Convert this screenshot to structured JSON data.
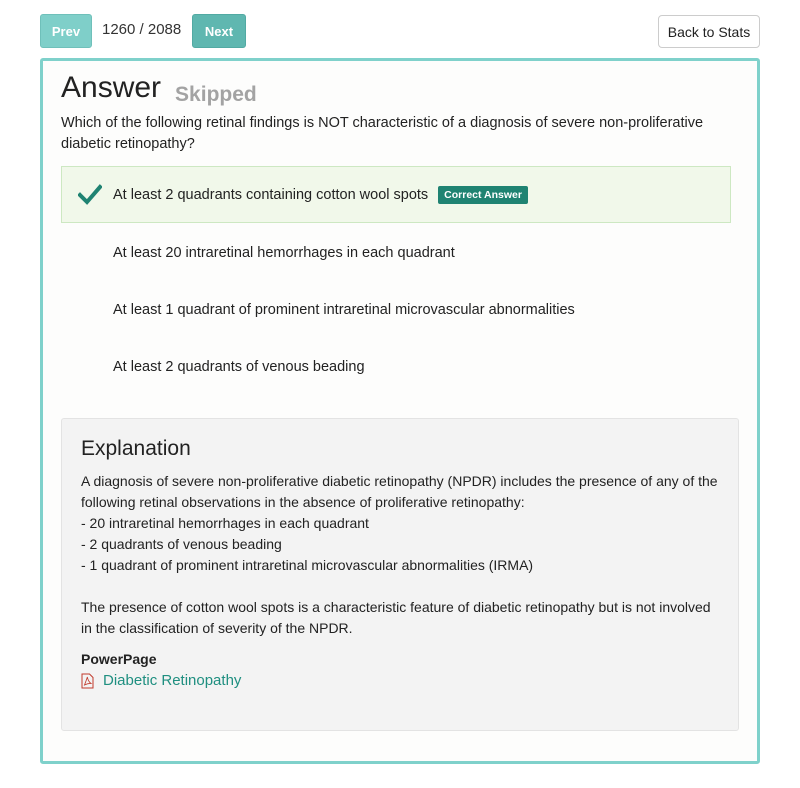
{
  "nav": {
    "prev_label": "Prev",
    "counter": "1260 / 2088",
    "next_label": "Next",
    "back_label": "Back to Stats"
  },
  "answer": {
    "title": "Answer",
    "status": "Skipped",
    "question": "Which of the following retinal findings is NOT characteristic of a diagnosis of severe non-proliferative diabetic retinopathy?",
    "options": [
      {
        "text": "At least 2 quadrants containing cotton wool spots",
        "correct": true
      },
      {
        "text": "At least 20 intraretinal hemorrhages in each quadrant",
        "correct": false
      },
      {
        "text": "At least 1 quadrant of prominent intraretinal microvascular abnormalities",
        "correct": false
      },
      {
        "text": "At least 2 quadrants of venous beading",
        "correct": false
      }
    ],
    "correct_badge": "Correct Answer"
  },
  "explanation": {
    "title": "Explanation",
    "lines": [
      "A diagnosis of severe non-proliferative diabetic retinopathy (NPDR) includes the presence of any of the following retinal observations in the absence of proliferative retinopathy:",
      "- 20 intraretinal hemorrhages in each quadrant",
      "- 2 quadrants of venous beading",
      "- 1 quadrant of prominent intraretinal microvascular abnormalities (IRMA)",
      "The presence of cotton wool spots is a characteristic feature of diabetic retinopathy but is not involved in the classification of severity of the NPDR."
    ],
    "powerpage_label": "PowerPage",
    "powerpage_link": "Diabetic Retinopathy"
  },
  "colors": {
    "accent_border": "#7fd1cb",
    "correct_badge": "#1f8372",
    "check": "#1f8372",
    "link": "#1f8f80"
  },
  "icons": {
    "check": "check-icon",
    "pdf": "pdf-file-icon"
  }
}
